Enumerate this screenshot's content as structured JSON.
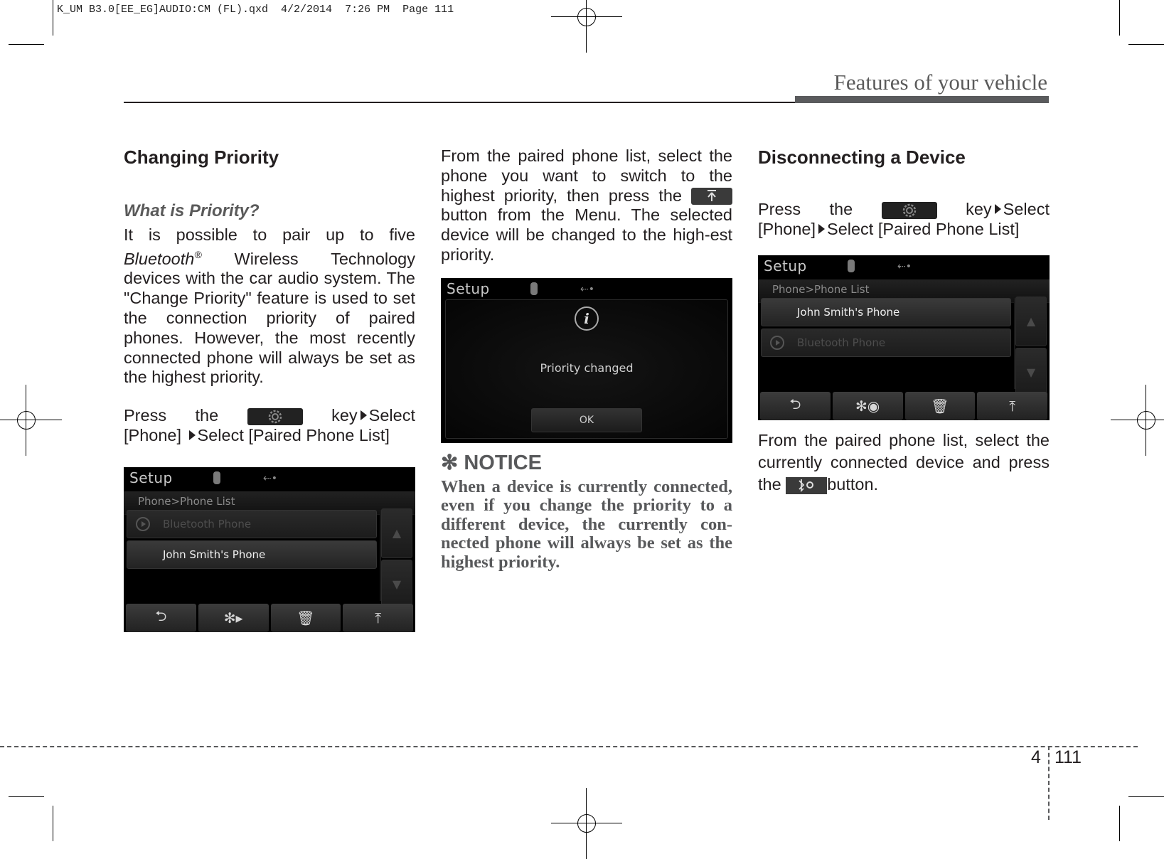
{
  "slug": "K_UM B3.0[EE_EG]AUDIO:CM (FL).qxd  4/2/2014  7:26 PM  Page 111",
  "header": {
    "section_title": "Features of your vehicle"
  },
  "left_column": {
    "heading": "Changing Priority",
    "subheading": "What is Priority?",
    "intro_start": "It is possible to pair up to five",
    "intro_bluetooth": "Bluetooth",
    "intro_reg": "®",
    "intro_rest": " Wireless Technology devices with the car audio system. The \"Change Priority\" feature is used to set the connection priority of paired phones. However, the most recently connected phone will always be set as the highest priority.",
    "press_the": "Press the",
    "key_select": "key",
    "select": "Select",
    "phone_bracket": "[Phone]",
    "select_paired": "Select [Paired Phone List]",
    "setup_key_icon": "gear-icon"
  },
  "screen_left": {
    "title": "Setup",
    "breadcrumb": "Phone>Phone List",
    "items": [
      {
        "label": "Bluetooth Phone",
        "state": "dimmed",
        "icon": "play-icon"
      },
      {
        "label": "John Smith's Phone",
        "state": "highlighted"
      }
    ],
    "scroll_up": "▲",
    "scroll_down": "▼",
    "toolbar": [
      {
        "icon": "back-icon",
        "glyph": "⮌"
      },
      {
        "icon": "bluetooth-connect-icon",
        "glyph": "✻▸"
      },
      {
        "icon": "trash-icon",
        "glyph": "🗑"
      },
      {
        "icon": "priority-top-icon",
        "glyph": "⤒"
      }
    ]
  },
  "middle_column": {
    "body_part1": "From the paired phone list, select the phone you want to switch to the highest priority, then press the",
    "body_part2": "button from the Menu. The selected device will be changed to the high-est priority.",
    "priority_button_icon": "priority-top-icon",
    "notice_heading": "✻ NOTICE",
    "notice_body": "When a device is currently connected, even if you change the priority to a different device, the currently con-nected phone will always be set as the highest priority."
  },
  "screen_middle": {
    "title": "Setup",
    "popup_icon": "i",
    "popup_message": "Priority changed",
    "ok_label": "OK"
  },
  "right_column": {
    "heading": "Disconnecting a Device",
    "press_the": "Press the",
    "key_select": "key",
    "select": "Select",
    "phone_bracket": "[Phone]",
    "select_paired": "Select [Paired Phone List]",
    "body_part1": "From the paired phone list, select the currently connected device and press the",
    "body_part2": "button.",
    "disconnect_button_icon": "bluetooth-disconnect-icon"
  },
  "screen_right": {
    "title": "Setup",
    "breadcrumb": "Phone>Phone List",
    "items": [
      {
        "label": "John Smith's Phone",
        "state": "highlighted"
      },
      {
        "label": "Bluetooth Phone",
        "state": "dimmed",
        "icon": "play-icon"
      }
    ],
    "scroll_up": "▲",
    "scroll_down": "▼",
    "toolbar": [
      {
        "icon": "back-icon",
        "glyph": "⮌"
      },
      {
        "icon": "bluetooth-disconnect-icon",
        "glyph": "✻◉"
      },
      {
        "icon": "trash-icon",
        "glyph": "🗑"
      },
      {
        "icon": "priority-top-icon",
        "glyph": "⤒"
      }
    ]
  },
  "footer": {
    "chapter": "4",
    "page": "111"
  }
}
